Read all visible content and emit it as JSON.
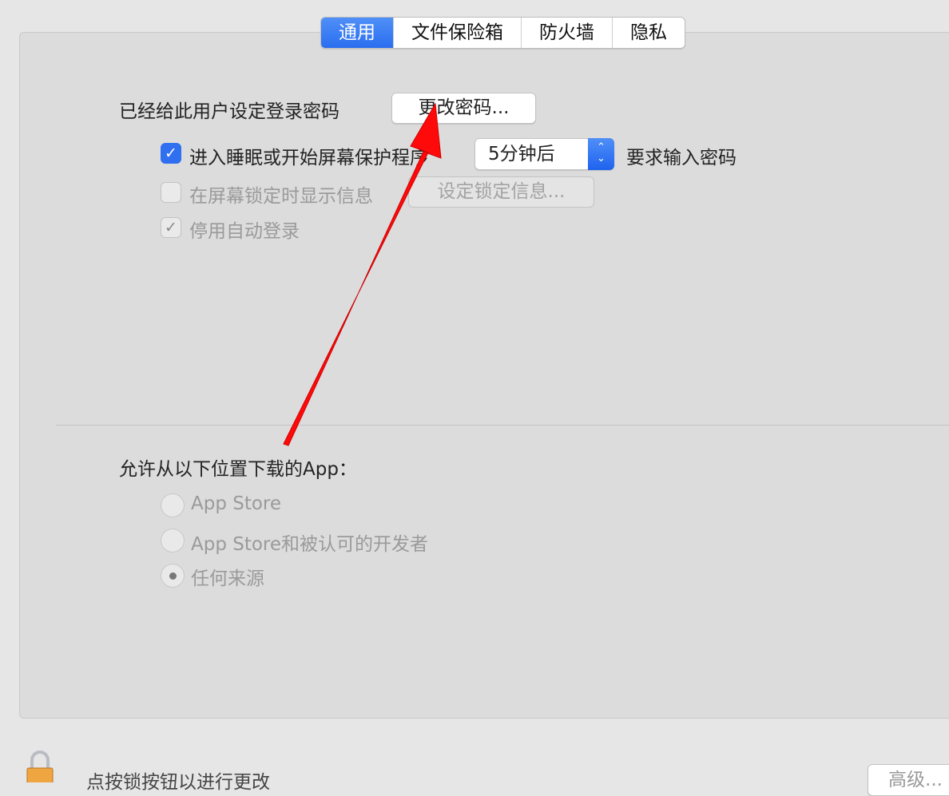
{
  "tabs": [
    {
      "label": "通用",
      "active": true
    },
    {
      "label": "文件保险箱"
    },
    {
      "label": "防火墙"
    },
    {
      "label": "隐私"
    }
  ],
  "general": {
    "password_label": "已经给此用户设定登录密码",
    "change_password_button": "更改密码...",
    "require_password": {
      "checked": true,
      "label": "进入睡眠或开始屏幕保护程序",
      "delay": "5分钟后",
      "suffix": "要求输入密码"
    },
    "show_message": {
      "checked": false,
      "enabled": false,
      "label": "在屏幕锁定时显示信息",
      "button": "设定锁定信息..."
    },
    "disable_auto_login": {
      "checked": true,
      "enabled": false,
      "label": "停用自动登录"
    }
  },
  "downloads": {
    "label": "允许从以下位置下载的App：",
    "options": [
      {
        "label": "App Store",
        "selected": false
      },
      {
        "label": "App Store和被认可的开发者",
        "selected": false
      },
      {
        "label": "任何来源",
        "selected": true
      }
    ]
  },
  "footer": {
    "lock_text": "点按锁按钮以进行更改",
    "advanced_button": "高级..."
  },
  "annotation": {
    "color": "#ff0000"
  }
}
